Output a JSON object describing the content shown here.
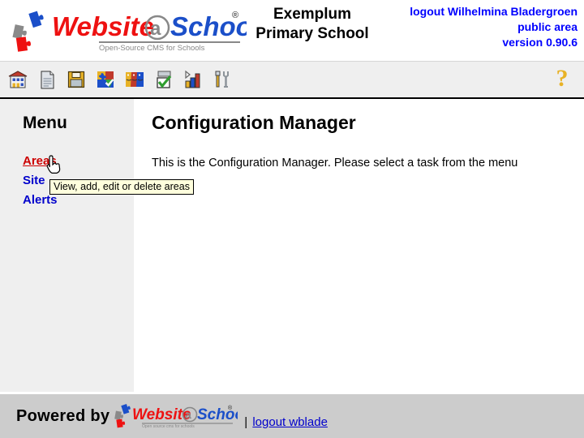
{
  "brand": {
    "name_part1": "Website",
    "name_at": "@",
    "name_part2": "School",
    "registered": "®",
    "tagline": "Open-Source CMS for Schools",
    "footer_tagline": "Open source cms for schools",
    "color_red": "#ee1111",
    "color_blue": "#1111cc",
    "color_gray": "#999999"
  },
  "header": {
    "school_line1": "Exemplum",
    "school_line2": "Primary School",
    "logout_user": "logout Wilhelmina Bladergroen",
    "area": "public area",
    "version": "version 0.90.6"
  },
  "toolbar": {
    "items": [
      {
        "name": "school-icon",
        "title": "School"
      },
      {
        "name": "page-icon",
        "title": "Pages"
      },
      {
        "name": "save-floppy-icon",
        "title": "Save"
      },
      {
        "name": "modules-puzzle-icon",
        "title": "Modules"
      },
      {
        "name": "users-faces-icon",
        "title": "Users"
      },
      {
        "name": "tasks-checkbox-icon",
        "title": "Tasks"
      },
      {
        "name": "statistics-bars-icon",
        "title": "Statistics"
      },
      {
        "name": "tools-icon",
        "title": "Tools"
      }
    ],
    "help_label": "?"
  },
  "sidebar": {
    "heading": "Menu",
    "items": [
      {
        "label": "Areas",
        "state": "hovered"
      },
      {
        "label": "Site",
        "state": "normal"
      },
      {
        "label": "Alerts",
        "state": "normal"
      }
    ]
  },
  "main": {
    "title": "Configuration Manager",
    "body": "This is the Configuration Manager. Please select a task from the menu"
  },
  "tooltip": {
    "text": "View, add, edit or delete areas"
  },
  "footer": {
    "powered_by": "Powered by",
    "separator": "|",
    "logout_label": "logout wblade"
  },
  "colors": {
    "link_blue": "#0000cc",
    "link_hover_red": "#cc0000",
    "toolbar_bg": "#efefef",
    "sidebar_bg": "#efefef",
    "footer_bg": "#cccccc",
    "help_yellow": "#e8b226",
    "tooltip_bg": "#ffffdd"
  }
}
